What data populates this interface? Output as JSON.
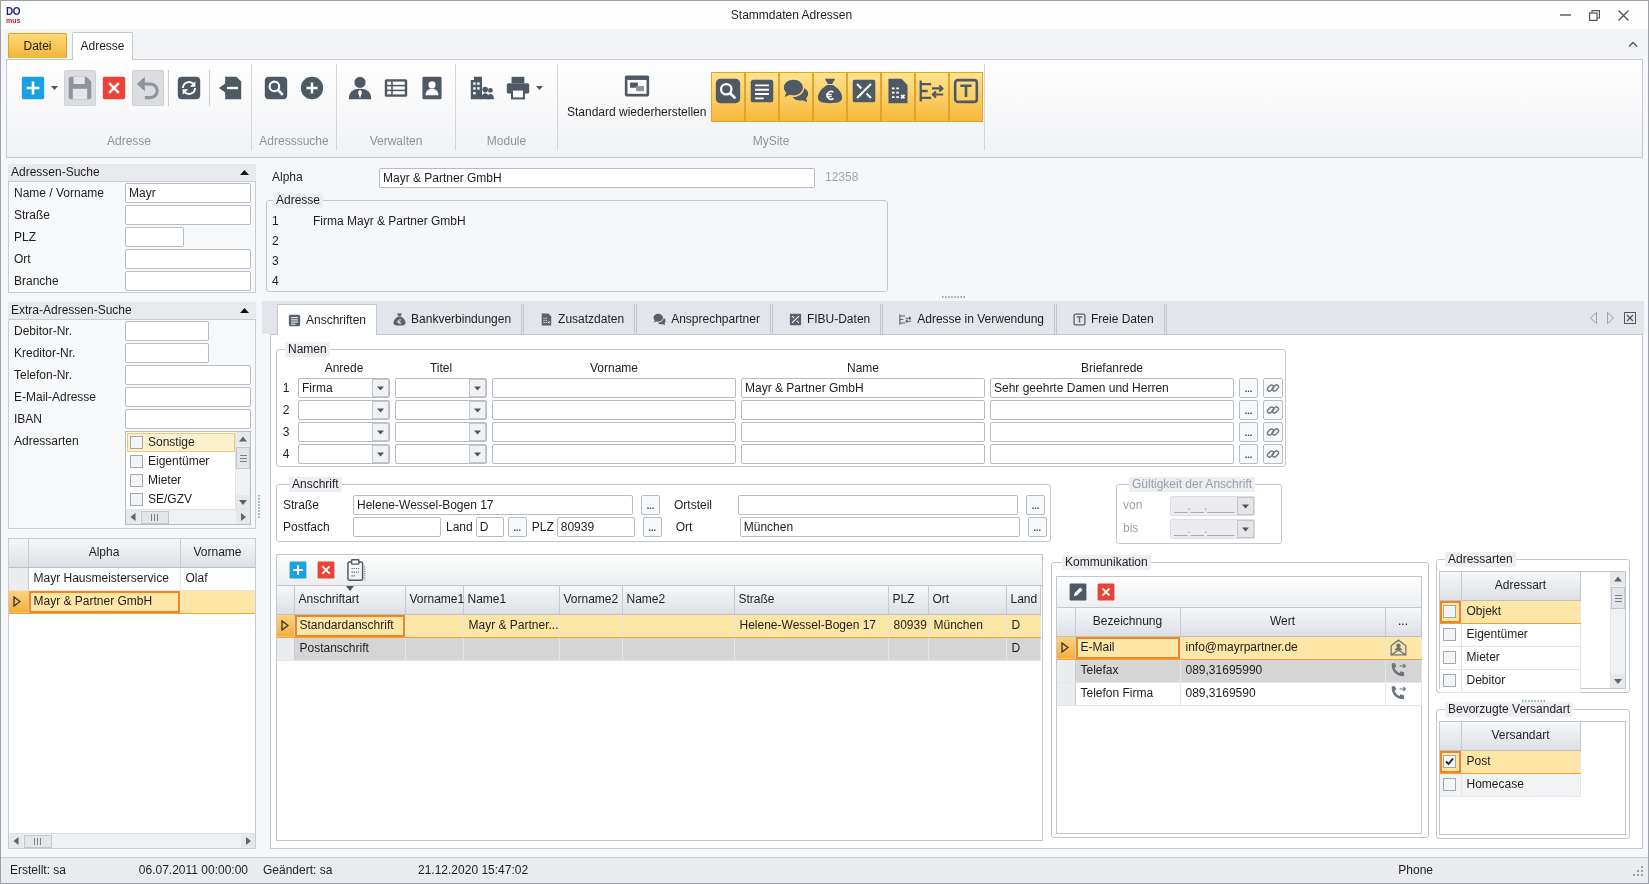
{
  "window": {
    "logo": {
      "top": "DO",
      "bottom": "mus"
    },
    "title": "Stammdaten Adressen"
  },
  "ribbon": {
    "tabs": [
      {
        "label": "Datei",
        "kind": "file",
        "selected": false
      },
      {
        "label": "Adresse",
        "kind": "page",
        "selected": true
      }
    ],
    "groups": [
      {
        "label": "Adresse",
        "buttons": [
          {
            "kind": "new",
            "dropdown": true,
            "disabled": false,
            "active": false
          },
          {
            "kind": "save",
            "dropdown": false,
            "disabled": true,
            "active": false
          },
          {
            "kind": "delete",
            "dropdown": false,
            "disabled": false,
            "active": false
          },
          {
            "kind": "undo",
            "dropdown": false,
            "disabled": true,
            "active": false
          },
          {
            "kind": "refresh",
            "separator_before": true,
            "dropdown": false,
            "disabled": false,
            "active": false
          },
          {
            "kind": "exit",
            "separator_before": true,
            "dropdown": false,
            "disabled": false,
            "active": false
          }
        ]
      },
      {
        "label": "Adresssuche",
        "buttons": [
          {
            "kind": "search",
            "dropdown": false,
            "disabled": false,
            "active": false
          },
          {
            "kind": "add",
            "dropdown": false,
            "disabled": false,
            "active": false
          }
        ]
      },
      {
        "label": "Verwalten",
        "buttons": [
          {
            "kind": "person",
            "dropdown": false,
            "disabled": false,
            "active": false
          },
          {
            "kind": "list",
            "dropdown": false,
            "disabled": false,
            "active": false
          },
          {
            "kind": "card",
            "dropdown": false,
            "disabled": false,
            "active": false
          }
        ]
      },
      {
        "label": "Module",
        "buttons": [
          {
            "kind": "buildings",
            "dropdown": false,
            "disabled": false,
            "active": false
          },
          {
            "kind": "print",
            "dropdown": true,
            "disabled": false,
            "active": false
          }
        ]
      },
      {
        "label": "MySite",
        "buttons": [
          {
            "kind": "restore",
            "label": "Standard wiederherstellen",
            "dropdown": false,
            "disabled": false,
            "active": false
          },
          {
            "kind": "search",
            "dropdown": false,
            "disabled": false,
            "active": true
          },
          {
            "kind": "document",
            "dropdown": false,
            "disabled": false,
            "active": true
          },
          {
            "kind": "chat",
            "dropdown": false,
            "disabled": false,
            "active": true
          },
          {
            "kind": "moneybag",
            "dropdown": false,
            "disabled": false,
            "active": true
          },
          {
            "kind": "tools",
            "dropdown": false,
            "disabled": false,
            "active": true
          },
          {
            "kind": "sheet",
            "dropdown": false,
            "disabled": false,
            "active": true
          },
          {
            "kind": "transfer",
            "dropdown": false,
            "disabled": false,
            "active": true
          },
          {
            "kind": "textframe",
            "dropdown": false,
            "disabled": false,
            "active": true
          }
        ]
      }
    ]
  },
  "search_panels": [
    {
      "title": "Adressen-Suche",
      "expanded": true,
      "fields": [
        {
          "label": "Name / Vorname",
          "value": "Mayr",
          "kind": "long"
        },
        {
          "label": "Straße",
          "kind": "long"
        },
        {
          "label": "PLZ",
          "kind": "short"
        },
        {
          "label": "Ort",
          "kind": "long"
        },
        {
          "label": "Branche",
          "kind": "long"
        }
      ]
    },
    {
      "title": "Extra-Adressen-Suche",
      "expanded": true,
      "fields": [
        {
          "label": "Debitor-Nr.",
          "kind": "medium"
        },
        {
          "label": "Kreditor-Nr.",
          "kind": "medium"
        },
        {
          "label": "Telefon-Nr.",
          "kind": "long"
        },
        {
          "label": "E-Mail-Adresse",
          "kind": "long"
        },
        {
          "label": "IBAN",
          "kind": "long"
        },
        {
          "label": "Adressarten",
          "kind": "checklist",
          "items": [
            {
              "label": "Sonstige",
              "checked": false,
              "selected": true
            },
            {
              "label": "Eigentümer",
              "checked": false,
              "selected": false
            },
            {
              "label": "Mieter",
              "checked": false,
              "selected": false
            },
            {
              "label": "SE/GZV",
              "checked": false,
              "selected": false
            }
          ]
        }
      ]
    }
  ],
  "results": {
    "columns": [
      "Alpha",
      "Vorname"
    ],
    "rows": [
      {
        "alpha": "Mayr Hausmeisterservice",
        "vorname": "Olaf",
        "selected": false
      },
      {
        "alpha": "Mayr & Partner GmbH",
        "selected": true
      }
    ]
  },
  "alpha": {
    "label": "Alpha",
    "value": "Mayr & Partner GmbH",
    "number": "12358"
  },
  "address": {
    "title": "Adresse",
    "lines": [
      {
        "number": "1",
        "text": "Firma Mayr & Partner GmbH"
      },
      {
        "number": "2"
      },
      {
        "number": "3"
      },
      {
        "number": "4"
      }
    ]
  },
  "tabs": [
    {
      "label": "Anschriften",
      "kind": "document",
      "selected": true
    },
    {
      "label": "Bankverbindungen",
      "kind": "moneybag",
      "selected": false
    },
    {
      "label": "Zusatzdaten",
      "kind": "sheet",
      "selected": false
    },
    {
      "label": "Ansprechpartner",
      "kind": "chat",
      "selected": false
    },
    {
      "label": "FIBU-Daten",
      "kind": "tools",
      "selected": false
    },
    {
      "label": "Adresse in Verwendung",
      "kind": "transfer",
      "selected": false
    },
    {
      "label": "Freie Daten",
      "kind": "textframe",
      "selected": false
    }
  ],
  "names": {
    "title": "Namen",
    "columns": [
      {
        "label": "Anrede",
        "kind": "dropdown"
      },
      {
        "label": "Titel",
        "kind": "dropdown"
      },
      {
        "label": "Vorname",
        "kind": "text"
      },
      {
        "label": "Name",
        "kind": "text"
      },
      {
        "label": "Briefanrede",
        "kind": "text"
      }
    ],
    "rows": [
      {
        "number": "1",
        "anrede": "Firma",
        "name": "Mayr & Partner GmbH",
        "briefanrede": "Sehr geehrte Damen und Herren",
        "button": "..."
      },
      {
        "number": "2",
        "button": "..."
      },
      {
        "number": "3",
        "button": "..."
      },
      {
        "number": "4",
        "button": "..."
      }
    ]
  },
  "postal": {
    "title": "Anschrift",
    "lines": [
      {
        "fields": [
          {
            "label": "Straße",
            "value": "Helene-Wessel-Bogen 17",
            "kind": "wide",
            "button": "..."
          },
          {
            "label": "Ortsteil",
            "kind": "wide",
            "button": "..."
          }
        ]
      },
      {
        "fields": [
          {
            "label": "Postfach",
            "kind": "medium"
          },
          {
            "label": "Land",
            "value": "D",
            "kind": "tiny",
            "button": "..."
          },
          {
            "label": "PLZ",
            "value": "80939",
            "kind": "small",
            "button": "..."
          },
          {
            "label": "Ort",
            "value": "München",
            "kind": "wide",
            "button": "..."
          }
        ]
      }
    ]
  },
  "validity": {
    "title": "Gültigkeit der Anschrift",
    "disabled": true,
    "fields": [
      {
        "label": "von",
        "placeholder": "__.__.____"
      },
      {
        "label": "bis",
        "placeholder": "__.__.____"
      }
    ]
  },
  "addresses": {
    "toolbar": [
      {
        "kind": "new"
      },
      {
        "kind": "delete"
      },
      {
        "kind": "clipboard"
      }
    ],
    "columns": [
      {
        "label": "Anschriftart",
        "sorted": true
      },
      {
        "label": "Vorname1",
        "sorted": false
      },
      {
        "label": "Name1",
        "sorted": false
      },
      {
        "label": "Vorname2",
        "sorted": false
      },
      {
        "label": "Name2",
        "sorted": false
      },
      {
        "label": "Straße",
        "sorted": false
      },
      {
        "label": "PLZ",
        "sorted": false
      },
      {
        "label": "Ort",
        "sorted": false
      },
      {
        "label": "Land",
        "sorted": false
      }
    ],
    "rows": [
      {
        "anschriftart": "Standardanschrift",
        "name1": "Mayr & Partner...",
        "strasse": "Helene-Wessel-Bogen 17",
        "plz": "80939",
        "ort": "München",
        "land": "D",
        "selected": true,
        "shaded": false
      },
      {
        "anschriftart": "Postanschrift",
        "land": "D",
        "selected": false,
        "shaded": true
      }
    ]
  },
  "communication": {
    "title": "Kommunikation",
    "toolbar": [
      {
        "kind": "edit"
      },
      {
        "kind": "delete"
      }
    ],
    "columns": [
      "Bezeichnung",
      "Wert",
      "..."
    ],
    "rows": [
      {
        "label": "E-Mail",
        "value": "info@mayrpartner.de",
        "kind": "email",
        "selected": true,
        "shaded": false
      },
      {
        "label": "Telefax",
        "value": "089,31695990",
        "kind": "phone",
        "selected": false,
        "shaded": true
      },
      {
        "label": "Telefon Firma",
        "value": "089,3169590",
        "kind": "phone",
        "selected": false,
        "shaded": false
      }
    ]
  },
  "address_types": {
    "title": "Adressarten",
    "column": "Adressart",
    "rows": [
      {
        "label": "Objekt",
        "checked": false,
        "selected": true
      },
      {
        "label": "Eigentümer",
        "checked": false,
        "selected": false
      },
      {
        "label": "Mieter",
        "checked": false,
        "selected": false
      },
      {
        "label": "Debitor",
        "checked": false,
        "selected": false
      }
    ]
  },
  "shipping": {
    "title": "Bevorzugte Versandart",
    "column": "Versandart",
    "rows": [
      {
        "label": "Post",
        "checked": true,
        "selected": true,
        "shaded": false
      },
      {
        "label": "Homecase",
        "checked": false,
        "selected": false,
        "shaded": true
      }
    ]
  },
  "status_bar": [
    "Erstellt: sa",
    "06.07.2011 00:00:00",
    "Geändert: sa",
    "21.12.2020 15:47:02",
    "Phone"
  ]
}
